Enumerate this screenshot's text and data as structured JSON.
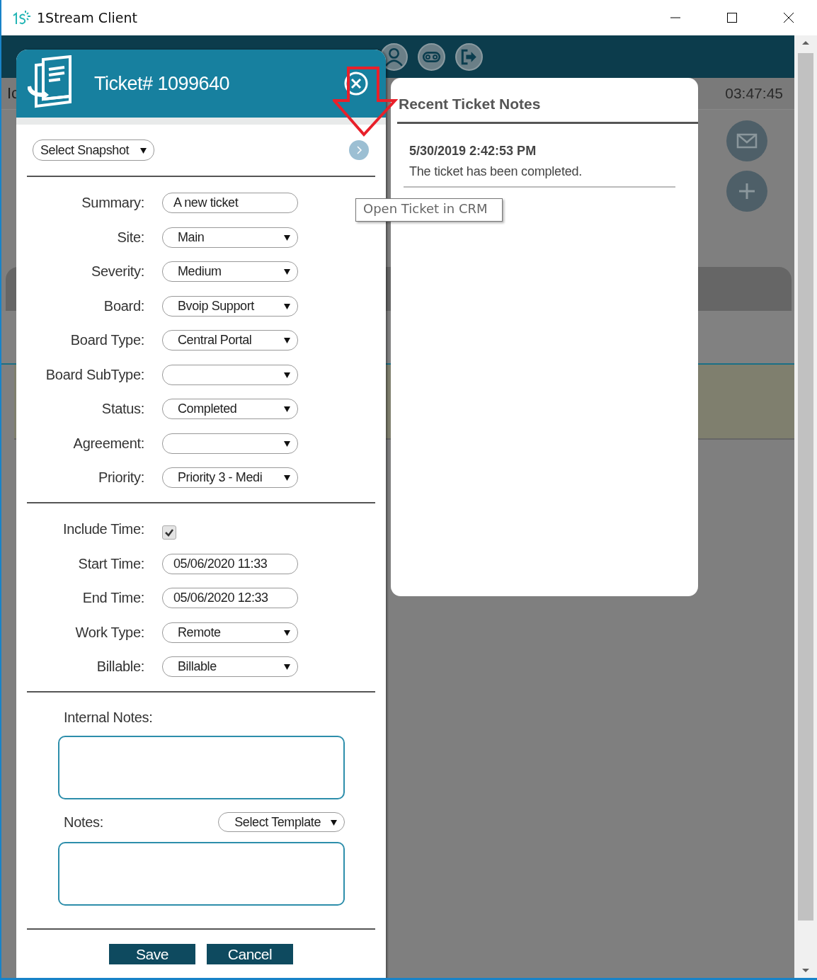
{
  "window": {
    "title": "1Stream Client"
  },
  "backdrop": {
    "label_fragment": "Ic",
    "timer": "03:47:45"
  },
  "ticket_dialog": {
    "title": "Ticket# 1099640",
    "snapshot": {
      "value": "Select Snapshot"
    },
    "sections": [
      [
        {
          "label": "Summary:",
          "kind": "text",
          "value": "A new ticket"
        },
        {
          "label": "Site:",
          "kind": "select",
          "value": "Main"
        },
        {
          "label": "Severity:",
          "kind": "select",
          "value": "Medium"
        },
        {
          "label": "Board:",
          "kind": "select",
          "value": "Bvoip Support"
        },
        {
          "label": "Board Type:",
          "kind": "select",
          "value": "Central Portal"
        },
        {
          "label": "Board SubType:",
          "kind": "select"
        },
        {
          "label": "Status:",
          "kind": "select",
          "value": "Completed"
        },
        {
          "label": "Agreement:",
          "kind": "select"
        },
        {
          "label": "Priority:",
          "kind": "select",
          "value": "Priority 3 - Medi"
        }
      ],
      [
        {
          "label": "Include Time:",
          "kind": "checkbox",
          "checked": true
        },
        {
          "label": "Start Time:",
          "kind": "text",
          "value": "05/06/2020 11:33"
        },
        {
          "label": "End Time:",
          "kind": "text",
          "value": "05/06/2020 12:33"
        },
        {
          "label": "Work Type:",
          "kind": "select",
          "value": "Remote"
        },
        {
          "label": "Billable:",
          "kind": "select",
          "value": "Billable"
        }
      ]
    ],
    "internal_notes": {
      "label": "Internal Notes:"
    },
    "notes": {
      "label": "Notes:",
      "template": "Select Template"
    },
    "buttons": [
      "Save",
      "Cancel"
    ]
  },
  "recent_notes": {
    "title": "Recent Ticket Notes",
    "notes": [
      {
        "timestamp": "5/30/2019 2:42:53 PM",
        "text": "The ticket has been completed."
      }
    ]
  },
  "tooltip": {
    "text": "Open Ticket in CRM"
  }
}
